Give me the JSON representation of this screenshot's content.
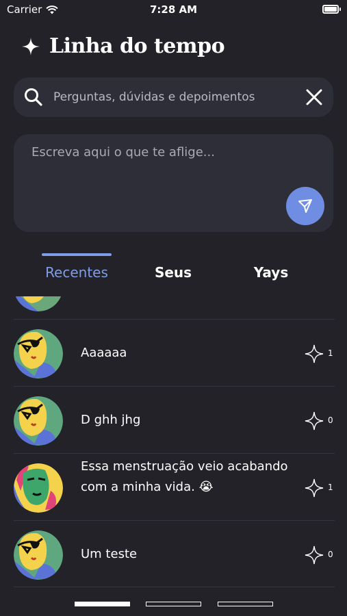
{
  "status_bar": {
    "carrier": "Carrier",
    "time": "7:28 AM"
  },
  "header": {
    "title": "Linha do tempo",
    "icon": "sparkle-icon"
  },
  "search": {
    "placeholder": "Perguntas, dúvidas e depoimentos",
    "value": ""
  },
  "compose": {
    "placeholder": "Escreva aqui o que te aflige...",
    "value": ""
  },
  "tabs": [
    {
      "label": "Recentes",
      "active": true
    },
    {
      "label": "Seus",
      "active": false
    },
    {
      "label": "Yays",
      "active": false
    }
  ],
  "posts": [
    {
      "text": "Aaaaaa",
      "stars": "1",
      "avatar": "yellow-face-sunglasses"
    },
    {
      "text": "D ghh jhg",
      "stars": "0",
      "avatar": "yellow-face-sunglasses"
    },
    {
      "text": "Essa menstruação veio acabando com a minha vida. 😭",
      "stars": "1",
      "avatar": "green-face"
    },
    {
      "text": "Um teste",
      "stars": "0",
      "avatar": "yellow-face-sunglasses"
    }
  ],
  "colors": {
    "background": "#222228",
    "surface": "#2d2e37",
    "accent": "#7f9de9",
    "send_button": "#6f8de3"
  }
}
